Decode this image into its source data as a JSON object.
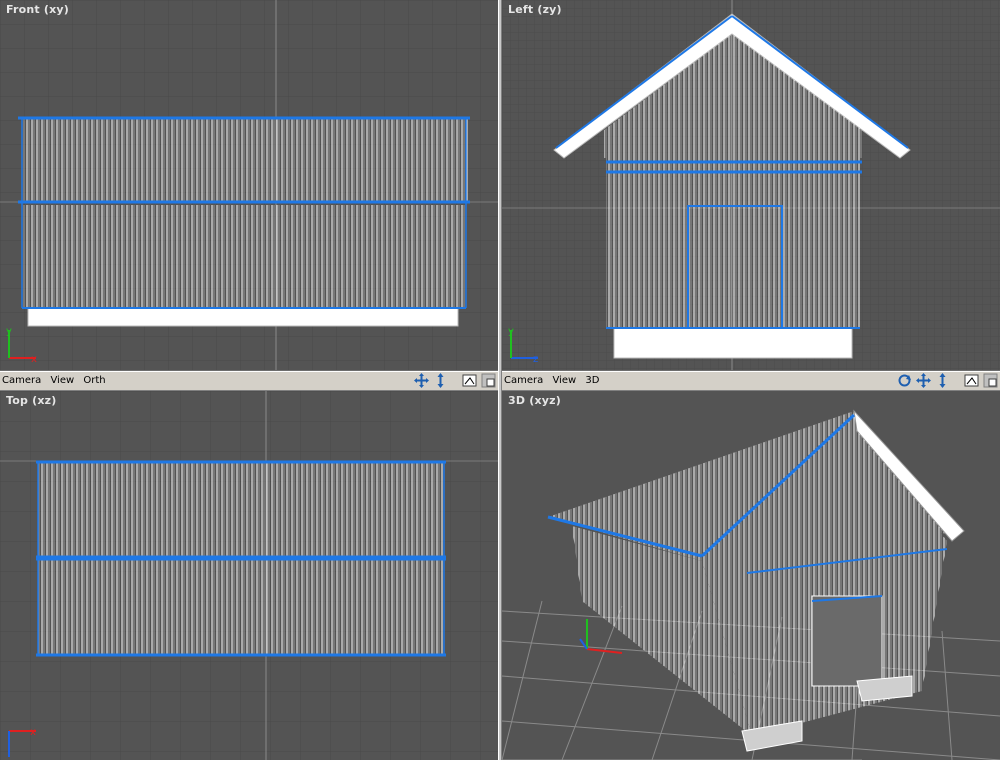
{
  "viewports": {
    "front": {
      "label": "Front (xy)"
    },
    "left": {
      "label": "Left (zy)"
    },
    "top": {
      "label": "Top (xz)"
    },
    "persp": {
      "label": "3D (xyz)"
    }
  },
  "toolbars": {
    "left": {
      "camera": "Camera",
      "view": "View",
      "mode": "Orth"
    },
    "right": {
      "camera": "Camera",
      "view": "View",
      "mode": "3D"
    }
  },
  "axes": {
    "x": "x",
    "y": "y",
    "z": "z"
  },
  "icons": [
    "move-icon",
    "zoom-icon",
    "render-icon",
    "maximize-icon",
    "rotate-icon"
  ],
  "colors": {
    "background": "#545454",
    "grid": "#4a4a4a",
    "wire": "#ffffff",
    "selection": "#1e78e6",
    "axis_x": "#e02020",
    "axis_y": "#20c020",
    "axis_z": "#2060e0"
  }
}
